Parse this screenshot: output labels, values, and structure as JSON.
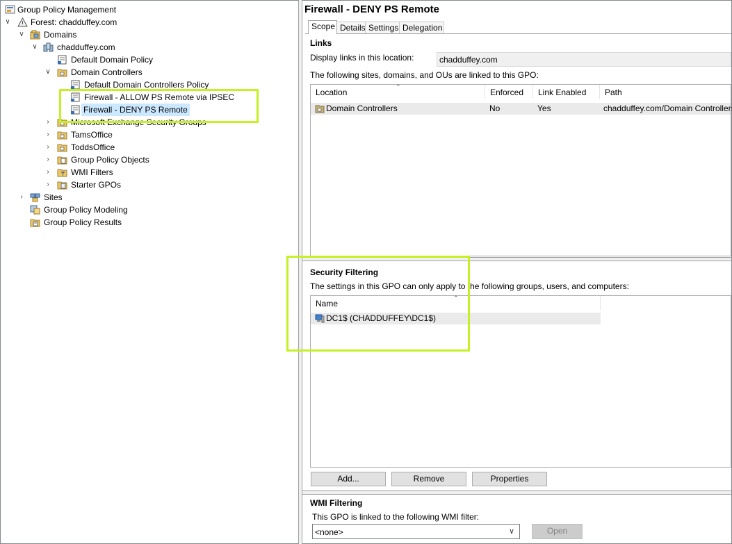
{
  "tree": {
    "root": "Group Policy Management",
    "forest": "Forest: chadduffey.com",
    "domains": "Domains",
    "domain": "chadduffey.com",
    "default_domain_policy": "Default Domain Policy",
    "domain_controllers": "Domain Controllers",
    "default_dc_policy": "Default Domain Controllers Policy",
    "fw_allow": "Firewall - ALLOW PS Remote via IPSEC",
    "fw_deny": "Firewall - DENY PS Remote",
    "exchange": "Microsoft Exchange Security Groups",
    "tams": "TamsOffice",
    "todds": "ToddsOffice",
    "gpo_objects": "Group Policy Objects",
    "wmi_filters": "WMI Filters",
    "starter": "Starter GPOs",
    "sites": "Sites",
    "modeling": "Group Policy Modeling",
    "results": "Group Policy Results"
  },
  "detail": {
    "title": "Firewall - DENY PS Remote",
    "tabs": [
      "Scope",
      "Details",
      "Settings",
      "Delegation"
    ],
    "links": {
      "heading": "Links",
      "display_label": "Display links in this location:",
      "display_value": "chadduffey.com",
      "description": "The following sites, domains, and OUs are linked to this GPO:",
      "columns": [
        "Location",
        "Enforced",
        "Link Enabled",
        "Path"
      ],
      "rows": [
        {
          "location": "Domain Controllers",
          "enforced": "No",
          "link_enabled": "Yes",
          "path": "chadduffey.com/Domain Controllers"
        }
      ]
    },
    "security": {
      "heading": "Security Filtering",
      "description": "The settings in this GPO can only apply to the following groups, users, and computers:",
      "column": "Name",
      "rows": [
        "DC1$ (CHADDUFFEY\\DC1$)"
      ],
      "add_label": "Add...",
      "remove_label": "Remove",
      "properties_label": "Properties"
    },
    "wmi": {
      "heading": "WMI Filtering",
      "description": "This GPO is linked to the following WMI filter:",
      "value": "<none>",
      "open_label": "Open"
    }
  },
  "colors": {
    "highlight": "#c5f022",
    "selection": "#cce8ff"
  }
}
